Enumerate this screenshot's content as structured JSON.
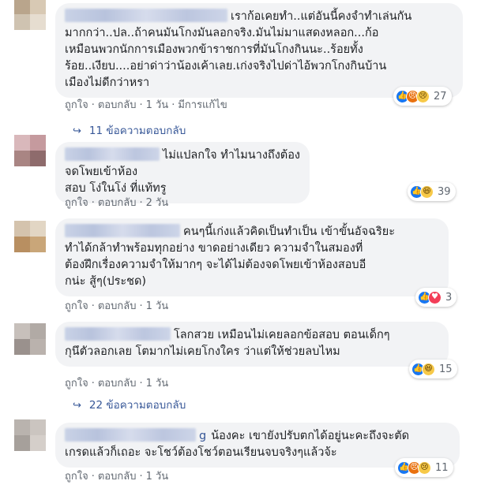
{
  "comments": [
    {
      "text": "เราก้อเคยทำ..แต่อันนี้คงจำทำเล่นกัน มากกว่า..ปล..ถ้าคนมันโกงมันลอกจริง.มันไม่มาแสดงหลอก...ก้อเหมือนพวกนักการเมืองพวกข้าราชการที่มันโกงกินนะ..ร้อยทั้งร้อย..เงียบ....อย่าด่าว่าน้องเค้าเลย.เก่งจริงไปด่าไอ้พวกโกงกินบ้านเมืองไม่ดีกว่าหรา",
      "lines": [
        "เราก้อเคยทำ..แต่อันนี้คงจำทำเล่นกัน",
        "มากกว่า..ปล..ถ้าคนมันโกงมันลอกจริง.มันไม่มาแสดงหลอก...ก้อ",
        "เหมือนพวกนักการเมืองพวกข้าราชการที่มันโกงกินนะ..ร้อยทั้ง",
        "ร้อย..เงียบ....อย่าด่าว่าน้องเค้าเลย.เก่งจริงไปด่าไอ้พวกโกงกินบ้าน",
        "เมืองไม่ดีกว่าหรา"
      ],
      "like": "ถูกใจ",
      "reply": "ตอบกลับ",
      "time": "1 วัน",
      "edited": "มีการแก้ไข",
      "reactions": [
        "like",
        "angry",
        "sad"
      ],
      "reaction_count": "27",
      "replies": "11 ข้อความตอบกลับ"
    },
    {
      "lines": [
        "ไม่แปลกใจ ทำไมนางถึงต้องจดโพยเข้าห้อง",
        "สอบ โง่ในโง่ ที่แท้ทรู"
      ],
      "like": "ถูกใจ",
      "reply": "ตอบกลับ",
      "time": "2 วัน",
      "reactions": [
        "like",
        "haha"
      ],
      "reaction_count": "39"
    },
    {
      "lines": [
        "คนๆนี้เก่งแล้วคิดเป็นทำเป็น เข้าขั้นอัจฉริยะ",
        "ทำได้กล้าทำพร้อมทุกอย่าง ขาดอย่างเดียว ความจำในสมองที่",
        "ต้องฝึกเรื่องความจำให้มากๆ จะได้ไม่ต้องจดโพยเข้าห้องสอบอี",
        "กน่ะ สู้ๆ(ประชด)"
      ],
      "like": "ถูกใจ",
      "reply": "ตอบกลับ",
      "time": "1 วัน",
      "reactions": [
        "like",
        "love"
      ],
      "reaction_count": "3"
    },
    {
      "lines": [
        "โลกสวย เหมือนไม่เคยลอกข้อสอบ ตอนเด็กๆ",
        "กุนึตัวลอกเลย โตมากไม่เคยโกงใคร ว่าแต่ให้ช่วยลบไหม"
      ],
      "like": "ถูกใจ",
      "reply": "ตอบกลับ",
      "time": "1 วัน",
      "reactions": [
        "like",
        "haha"
      ],
      "reaction_count": "15",
      "replies": "22 ข้อความตอบกลับ"
    },
    {
      "name_tail": "g",
      "lines": [
        "น้องคะ เขายังปรับตกได้อยู่นะคะถึงจะตัด",
        "เกรดแล้วก็เถอะ จะโชว์ต้องโชว์ตอนเรียนจบจริงๆแล้วจ้ะ"
      ],
      "like": "ถูกใจ",
      "reply": "ตอบกลับ",
      "time": "1 วัน",
      "reactions": [
        "like",
        "angry",
        "sad"
      ],
      "reaction_count": "11"
    }
  ],
  "colors": {
    "bubble": "#f2f3f5",
    "link": "#385898",
    "meta": "#606770",
    "like": "#1877f2"
  }
}
